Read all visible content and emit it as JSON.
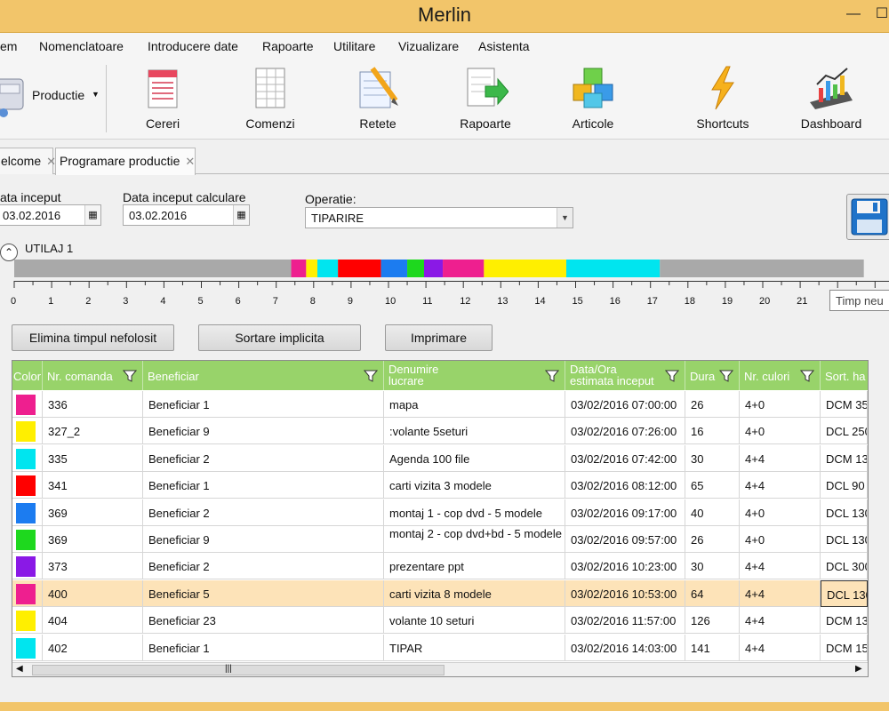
{
  "app": {
    "title": "Merlin"
  },
  "window_buttons": {
    "minimize": "—",
    "maximize": "☐"
  },
  "menu": [
    "em",
    "Nomenclatoare",
    "Introducere date",
    "Rapoarte",
    "Utilitare",
    "Vizualizare",
    "Asistenta"
  ],
  "toolbar": {
    "productie": "Productie",
    "buttons": [
      "Cereri",
      "Comenzi",
      "Retete",
      "Rapoarte",
      "Articole",
      "Shortcuts",
      "Dashboard"
    ]
  },
  "tabs": [
    {
      "label": "elcome",
      "close": "✕"
    },
    {
      "label": "Programare productie",
      "close": "✕"
    }
  ],
  "form": {
    "data_inceput_label": "ata inceput",
    "data_inceput_value": "03.02.2016",
    "data_calc_label": "Data inceput calculare",
    "data_calc_value": "03.02.2016",
    "operatie_label": "Operatie:",
    "operatie_value": "TIPARIRE"
  },
  "timeline": {
    "utilaj": "UTILAJ 1",
    "tooltip": "Timp neu",
    "ticks": [
      "0",
      "1",
      "2",
      "3",
      "4",
      "5",
      "6",
      "7",
      "8",
      "9",
      "10",
      "11",
      "12",
      "13",
      "14",
      "15",
      "16",
      "17",
      "18",
      "19",
      "20",
      "21"
    ],
    "segments": [
      {
        "start": 0,
        "end": 7.4,
        "color": "#a9a9a9"
      },
      {
        "start": 7.4,
        "end": 7.8,
        "color": "#ee1f8f"
      },
      {
        "start": 7.8,
        "end": 8.1,
        "color": "#ffef00"
      },
      {
        "start": 8.1,
        "end": 8.65,
        "color": "#00e5ef"
      },
      {
        "start": 8.65,
        "end": 9.8,
        "color": "#ff0000"
      },
      {
        "start": 9.8,
        "end": 10.5,
        "color": "#1c7cf0"
      },
      {
        "start": 10.5,
        "end": 10.95,
        "color": "#1ed81e"
      },
      {
        "start": 10.95,
        "end": 11.45,
        "color": "#8a19e6"
      },
      {
        "start": 11.45,
        "end": 12.55,
        "color": "#ee1f8f"
      },
      {
        "start": 12.55,
        "end": 14.75,
        "color": "#ffef00"
      },
      {
        "start": 14.75,
        "end": 17.25,
        "color": "#00e5ef"
      },
      {
        "start": 17.25,
        "end": 22.7,
        "color": "#a9a9a9"
      }
    ]
  },
  "buttons": {
    "elimina": "Elimina timpul nefolosit",
    "sortare": "Sortare implicita",
    "imprimare": "Imprimare"
  },
  "grid": {
    "headers": {
      "color": "Color",
      "nr_comanda": "Nr. comanda",
      "beneficiar": "Beneficiar",
      "denumire_1": "Denumire",
      "denumire_2": "lucrare",
      "data_1": "Data/Ora",
      "data_2": "estimata inceput",
      "durata": "Dura",
      "culori": "Nr. culori",
      "sort": "Sort. ha"
    },
    "rows": [
      {
        "color": "#ee1f8f",
        "nr": "336",
        "ben": "Beneficiar 1",
        "den": "mapa",
        "data": "03/02/2016 07:00:00",
        "dur": "26",
        "cul": "4+0",
        "sort": "DCM 35"
      },
      {
        "color": "#ffef00",
        "nr": "327_2",
        "ben": "Beneficiar 9",
        "den": ":volante 5seturi",
        "data": "03/02/2016 07:26:00",
        "dur": "16",
        "cul": "4+0",
        "sort": "DCL 250"
      },
      {
        "color": "#00e5ef",
        "nr": "335",
        "ben": "Beneficiar 2",
        "den": "Agenda 100 file",
        "data": "03/02/2016 07:42:00",
        "dur": "30",
        "cul": "4+4",
        "sort": "DCM 13"
      },
      {
        "color": "#ff0000",
        "nr": "341",
        "ben": "Beneficiar 1",
        "den": "carti vizita 3 modele",
        "data": "03/02/2016 08:12:00",
        "dur": "65",
        "cul": "4+4",
        "sort": "DCL 90"
      },
      {
        "color": "#1c7cf0",
        "nr": "369",
        "ben": "Beneficiar 2",
        "den": "montaj 1 - cop dvd - 5 modele",
        "data": "03/02/2016 09:17:00",
        "dur": "40",
        "cul": "4+0",
        "sort": "DCL 130"
      },
      {
        "color": "#1ed81e",
        "nr": "369",
        "ben": "Beneficiar 9",
        "den": "montaj 2 - cop dvd+bd - 5 modele",
        "data": "03/02/2016 09:57:00",
        "dur": "26",
        "cul": "4+0",
        "sort": "DCL 130"
      },
      {
        "color": "#8a19e6",
        "nr": "373",
        "ben": "Beneficiar 2",
        "den": "prezentare ppt",
        "data": "03/02/2016 10:23:00",
        "dur": "30",
        "cul": "4+4",
        "sort": "DCL 300"
      },
      {
        "color": "#ee1f8f",
        "nr": "400",
        "ben": "Beneficiar 5",
        "den": "carti vizita 8 modele",
        "data": "03/02/2016 10:53:00",
        "dur": "64",
        "cul": "4+4",
        "sort": "DCL 130"
      },
      {
        "color": "#ffef00",
        "nr": "404",
        "ben": "Beneficiar 23",
        "den": "volante 10 seturi",
        "data": "03/02/2016 11:57:00",
        "dur": "126",
        "cul": "4+4",
        "sort": "DCM 13"
      },
      {
        "color": "#00e5ef",
        "nr": "402",
        "ben": "Beneficiar 1",
        "den": "TIPAR",
        "data": "03/02/2016 14:03:00",
        "dur": "141",
        "cul": "4+4",
        "sort": "DCM 15"
      }
    ]
  },
  "scroll": {
    "left": "◀",
    "right": "▶",
    "grip": "|||"
  }
}
